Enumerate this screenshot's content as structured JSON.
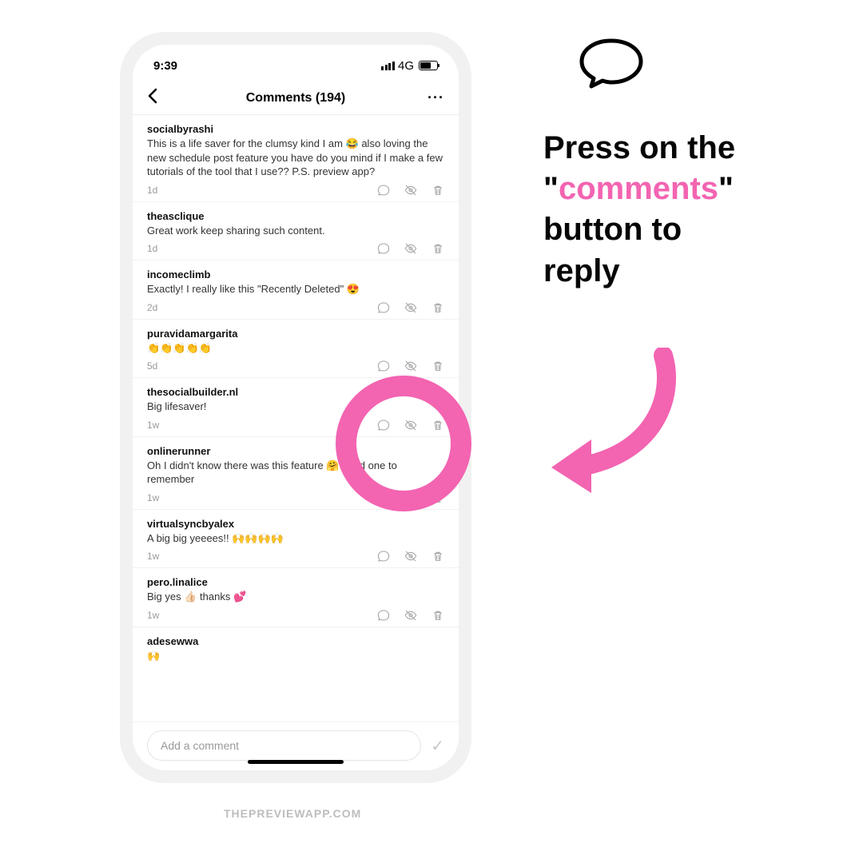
{
  "status": {
    "time": "9:39",
    "network": "4G"
  },
  "header": {
    "title": "Comments (194)"
  },
  "comments": [
    {
      "user": "socialbyrashi",
      "text": "This is a life saver for the clumsy kind I am 😂 also loving the new schedule post feature you have do you mind if I make a few tutorials of the tool that I use?? P.S. preview app?",
      "time": "1d"
    },
    {
      "user": "theasclique",
      "text": "Great work keep sharing such content.",
      "time": "1d"
    },
    {
      "user": "incomeclimb",
      "text": "Exactly! I really like this \"Recently Deleted\" 😍",
      "time": "2d"
    },
    {
      "user": "puravidamargarita",
      "text": "👏👏👏👏👏",
      "time": "5d"
    },
    {
      "user": "thesocialbuilder.nl",
      "text": "Big lifesaver!",
      "time": "1w"
    },
    {
      "user": "onlinerunner",
      "text": "Oh I didn't know there was this feature 🤗 good one to remember",
      "time": "1w"
    },
    {
      "user": "virtualsyncbyalex",
      "text": "A big big yeeees!! 🙌🙌🙌🙌",
      "time": "1w"
    },
    {
      "user": "pero.linalice",
      "text": "Big yes 👍🏻 thanks 💕",
      "time": "1w"
    },
    {
      "user": "adesewwa",
      "text": "🙌",
      "time": ""
    }
  ],
  "input": {
    "placeholder": "Add a comment"
  },
  "annotation": {
    "line1": "Press on the",
    "quote_open": "\"",
    "highlight": "comments",
    "quote_close": "\"",
    "line3": "button to",
    "line4": "reply"
  },
  "watermark": "THEPREVIEWAPP.COM",
  "colors": {
    "pink": "#f364b1"
  }
}
